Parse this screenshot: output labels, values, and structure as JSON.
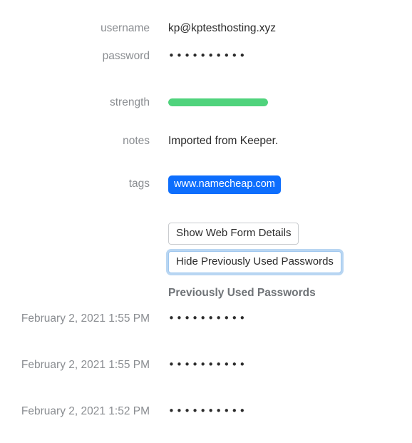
{
  "fields": {
    "username": {
      "label": "username",
      "value": "kp@kptesthosting.xyz"
    },
    "password": {
      "label": "password",
      "value": "••••••••••"
    },
    "strength": {
      "label": "strength",
      "percent": 100,
      "color": "#4fd37c",
      "track_color": "#e9ecef"
    },
    "notes": {
      "label": "notes",
      "value": "Imported from Keeper."
    },
    "tags": {
      "label": "tags",
      "value": "www.namecheap.com",
      "color": "#0d6efd",
      "text_color": "#ffffff"
    }
  },
  "buttons": {
    "web_form": "Show Web Form Details",
    "hide_history": "Hide Previously Used Passwords",
    "focus_ring_color": "#b9d6f2"
  },
  "history": {
    "title": "Previously Used Passwords",
    "entries": [
      {
        "date": "February 2, 2021 1:55 PM",
        "password": "••••••••••"
      },
      {
        "date": "February 2, 2021 1:55 PM",
        "password": "••••••••••"
      },
      {
        "date": "February 2, 2021 1:52 PM",
        "password": "••••••••••"
      }
    ]
  }
}
